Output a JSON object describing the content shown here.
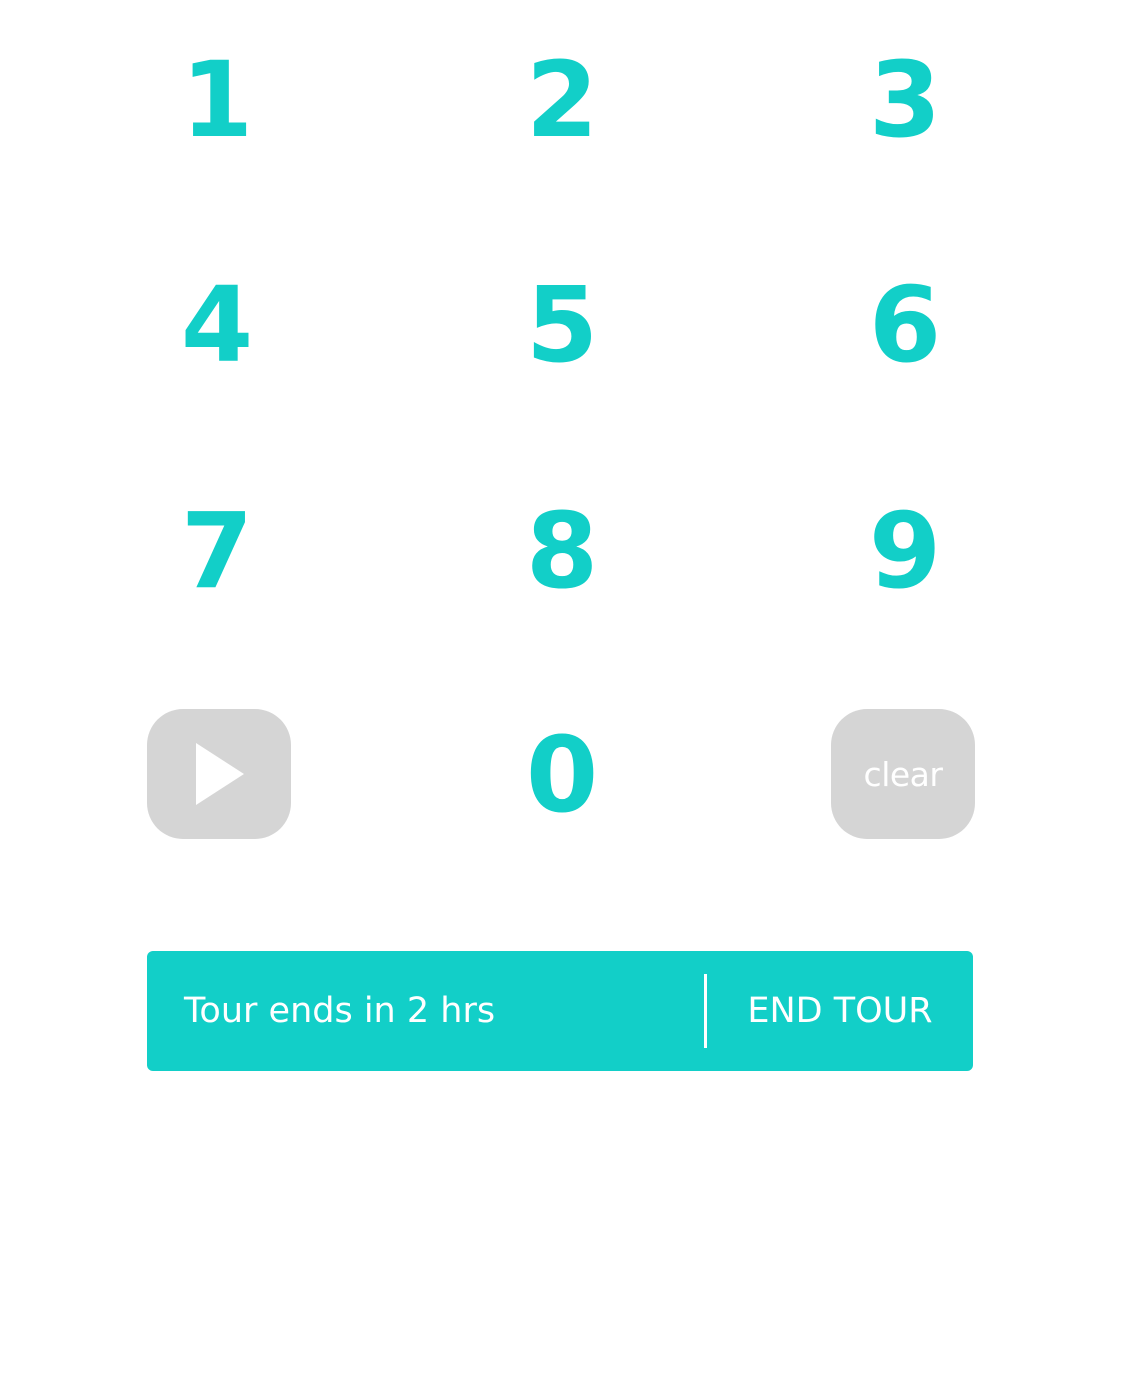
{
  "colors": {
    "accent": "#12CFC8",
    "disabled": "#D5D5D5",
    "background": "#FFFFFF",
    "on_accent": "#FFFFFF"
  },
  "keypad": {
    "keys": [
      "1",
      "2",
      "3",
      "4",
      "5",
      "6",
      "7",
      "8",
      "9",
      "0"
    ],
    "play_icon": "play-icon",
    "clear_label": "clear"
  },
  "tour_bar": {
    "status": "Tour ends in 2 hrs",
    "end_label": "END TOUR"
  }
}
